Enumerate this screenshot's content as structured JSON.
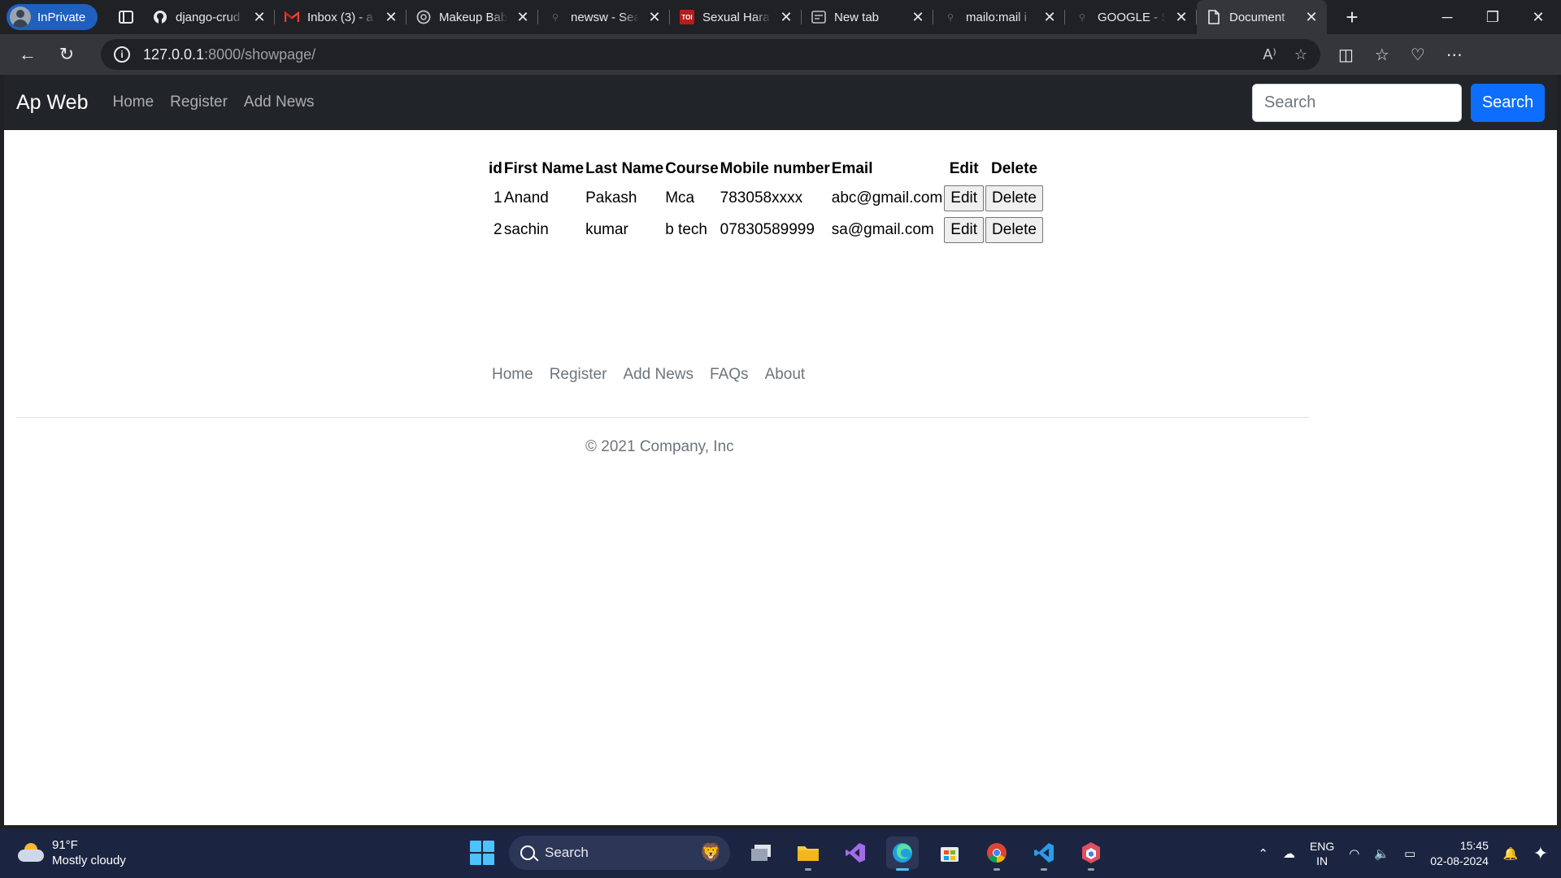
{
  "browser": {
    "inprivate_label": "InPrivate",
    "tabs": [
      {
        "title": "django-crud",
        "icon": "github-icon"
      },
      {
        "title": "Inbox (3) - a",
        "icon": "gmail-icon"
      },
      {
        "title": "Makeup Bab",
        "icon": "openai-icon"
      },
      {
        "title": "newsw - Sea",
        "icon": "search-icon"
      },
      {
        "title": "Sexual Hara",
        "icon": "toi-icon",
        "icon_text": "TOI"
      },
      {
        "title": "New tab",
        "icon": "newtab-icon"
      },
      {
        "title": "mailo:mail i",
        "icon": "search-icon"
      },
      {
        "title": "GOOGLE - S",
        "icon": "search-icon"
      },
      {
        "title": "Document",
        "icon": "document-icon",
        "active": true
      }
    ],
    "url_host": "127.0.0.1",
    "url_path": ":8000/showpage/"
  },
  "navbar": {
    "brand": "Ap Web",
    "links": [
      "Home",
      "Register",
      "Add News"
    ],
    "search_placeholder": "Search",
    "search_button": "Search",
    "bg_color": "#212529",
    "button_color": "#0d6efd"
  },
  "table": {
    "headers": [
      "id",
      "First Name",
      "Last Name",
      "Course",
      "Mobile number",
      "Email",
      "Edit",
      "Delete"
    ],
    "rows": [
      {
        "id": "1",
        "first": "Anand",
        "last": "Pakash",
        "course": "Mca",
        "mobile": "783058xxxx",
        "email": "abc@gmail.com",
        "edit": "Edit",
        "delete": "Delete"
      },
      {
        "id": "2",
        "first": "sachin",
        "last": "kumar",
        "course": "b tech",
        "mobile": "07830589999",
        "email": "sa@gmail.com",
        "edit": "Edit",
        "delete": "Delete"
      }
    ]
  },
  "footer": {
    "links": [
      "Home",
      "Register",
      "Add News",
      "FAQs",
      "About"
    ],
    "copyright": "© 2021 Company, Inc"
  },
  "taskbar": {
    "weather_temp": "91°F",
    "weather_desc": "Mostly cloudy",
    "search_label": "Search",
    "lang_line1": "ENG",
    "lang_line2": "IN",
    "time": "15:45",
    "date": "02-08-2024"
  }
}
